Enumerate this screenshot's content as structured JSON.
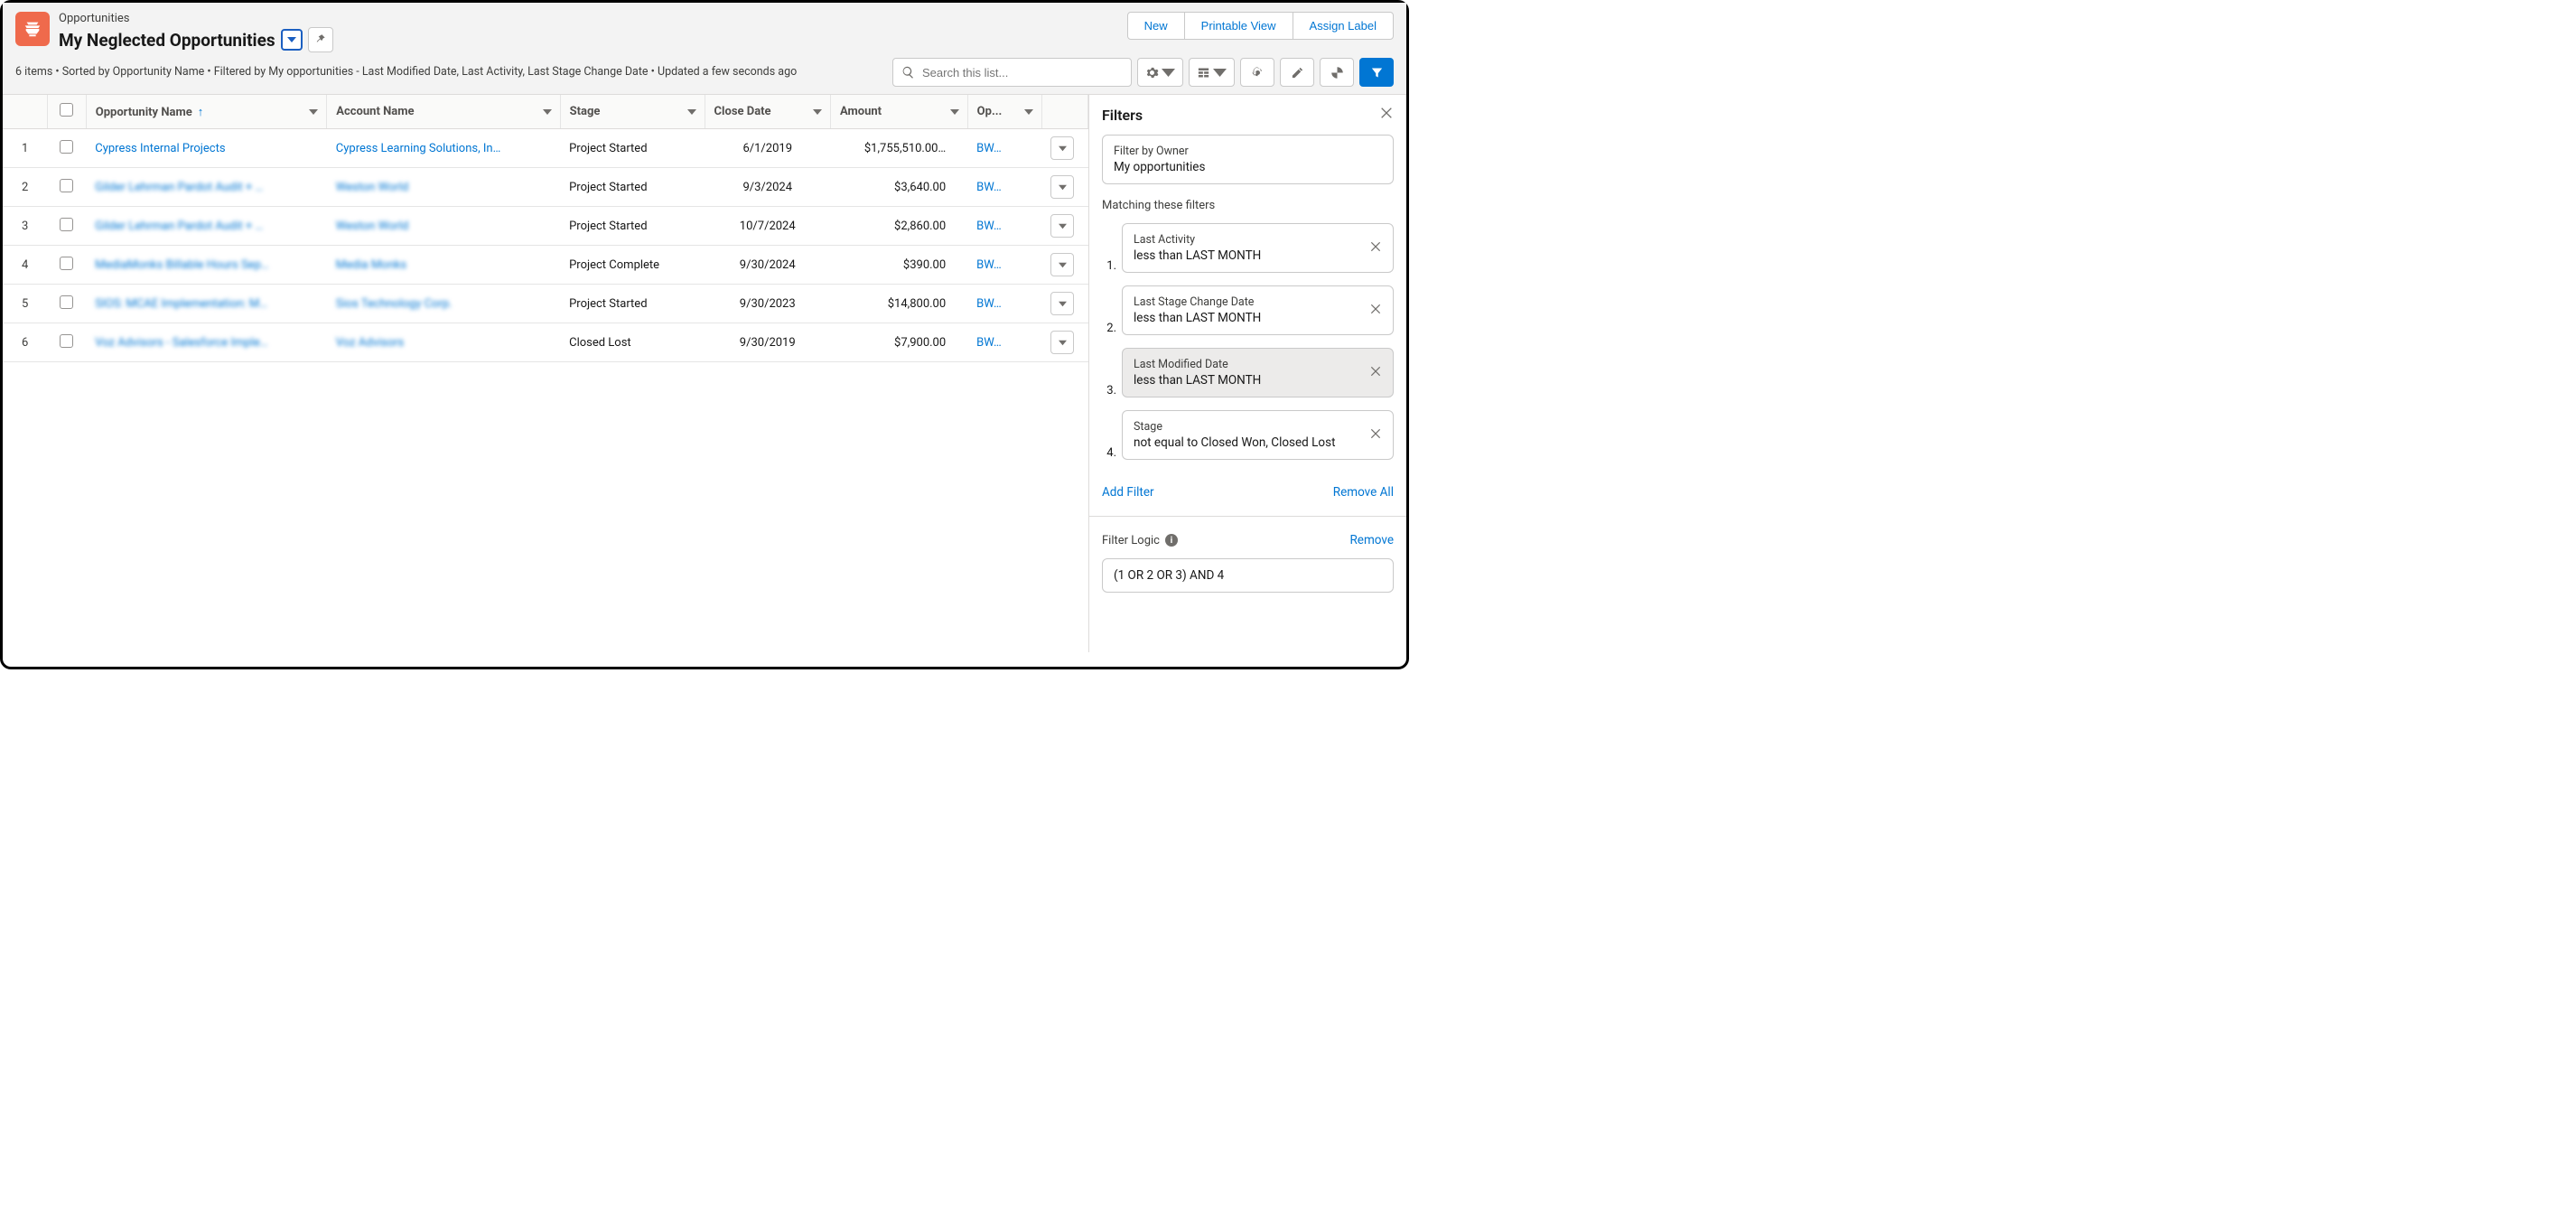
{
  "header": {
    "object_label": "Opportunities",
    "view_name": "My Neglected Opportunities",
    "meta": "6 items • Sorted by Opportunity Name • Filtered by My opportunities - Last Modified Date, Last Activity, Last Stage Change Date • Updated a few seconds ago",
    "actions": [
      "New",
      "Printable View",
      "Assign Label"
    ],
    "search_placeholder": "Search this list..."
  },
  "columns": {
    "name": "Opportunity Name",
    "account": "Account Name",
    "stage": "Stage",
    "close": "Close Date",
    "amount": "Amount",
    "owner": "Op..."
  },
  "rows": [
    {
      "num": "1",
      "name": "Cypress Internal Projects",
      "name_blur": false,
      "acct": "Cypress Learning Solutions, In…",
      "acct_blur": false,
      "stage": "Project Started",
      "close": "6/1/2019",
      "amt": "$1,755,510.00…",
      "owner": "BW…"
    },
    {
      "num": "2",
      "name": "Gilder Lehrman Pardot Audit + …",
      "name_blur": true,
      "acct": "Weston World",
      "acct_blur": true,
      "stage": "Project Started",
      "close": "9/3/2024",
      "amt": "$3,640.00",
      "owner": "BW…"
    },
    {
      "num": "3",
      "name": "Gilder Lehrman Pardot Audit + …",
      "name_blur": true,
      "acct": "Weston World",
      "acct_blur": true,
      "stage": "Project Started",
      "close": "10/7/2024",
      "amt": "$2,860.00",
      "owner": "BW…"
    },
    {
      "num": "4",
      "name": "MediaMonks Billable Hours Sep…",
      "name_blur": true,
      "acct": "Media Monks",
      "acct_blur": true,
      "stage": "Project Complete",
      "close": "9/30/2024",
      "amt": "$390.00",
      "owner": "BW…"
    },
    {
      "num": "5",
      "name": "SIOS: MCAE Implementation: M…",
      "name_blur": true,
      "acct": "Sios Technology Corp.",
      "acct_blur": true,
      "stage": "Project Started",
      "close": "9/30/2023",
      "amt": "$14,800.00",
      "owner": "BW…"
    },
    {
      "num": "6",
      "name": "Voz Advisors - Salesforce Imple…",
      "name_blur": true,
      "acct": "Voz Advisors",
      "acct_blur": true,
      "stage": "Closed Lost",
      "close": "9/30/2019",
      "amt": "$7,900.00",
      "owner": "BW…"
    }
  ],
  "filters": {
    "title": "Filters",
    "owner_label": "Filter by Owner",
    "owner_value": "My opportunities",
    "match_label": "Matching these filters",
    "cards": [
      {
        "num": "1.",
        "field": "Last Activity",
        "cond": "less than  LAST MONTH",
        "selected": false
      },
      {
        "num": "2.",
        "field": "Last Stage Change Date",
        "cond": "less than  LAST MONTH",
        "selected": false
      },
      {
        "num": "3.",
        "field": "Last Modified Date",
        "cond": "less than  LAST MONTH",
        "selected": true
      },
      {
        "num": "4.",
        "field": "Stage",
        "cond": "not equal to  Closed Won, Closed Lost",
        "selected": false
      }
    ],
    "add": "Add Filter",
    "remove_all": "Remove All",
    "logic_label": "Filter Logic",
    "logic_remove": "Remove",
    "logic_value": "(1 OR 2 OR 3) AND 4"
  }
}
